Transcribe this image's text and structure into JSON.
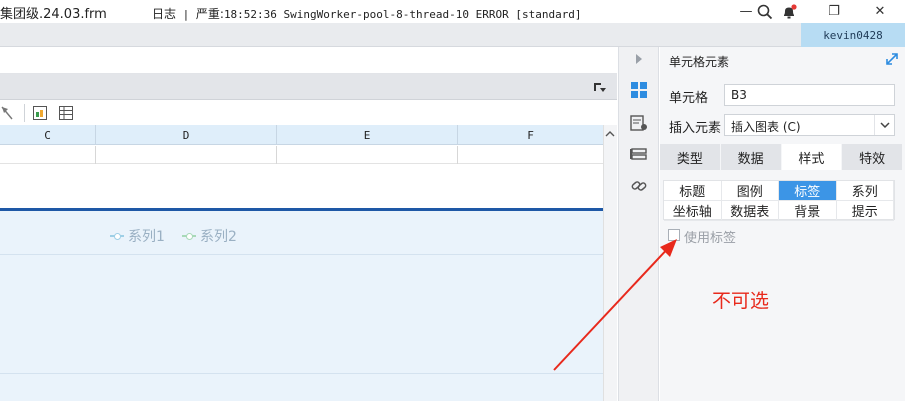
{
  "window": {
    "title": "集团级.24.03.frm",
    "minimize": "—",
    "maximize": "❐",
    "close": "✕"
  },
  "logbar": {
    "log_label": "日志",
    "separator": "|",
    "level_label": "严重:",
    "message": "18:52:36 SwingWorker-pool-8-thread-10 ERROR [standard]",
    "user": "kevin0428"
  },
  "sheet": {
    "columns": [
      "C",
      "D",
      "E",
      "F"
    ]
  },
  "chart": {
    "legend": [
      {
        "name": "系列1",
        "color": "#9ecfe6"
      },
      {
        "name": "系列2",
        "color": "#a8d9b8"
      }
    ]
  },
  "icons": {
    "side": [
      "cell-element-icon",
      "condition-attr-icon",
      "widget-icon",
      "hyperlink-icon"
    ]
  },
  "props": {
    "title": "单元格元素",
    "cell_label": "单元格",
    "cell_value": "B3",
    "insert_label": "插入元素",
    "insert_value": "插入图表",
    "insert_shortcut": "(C)",
    "tabs": [
      "类型",
      "数据",
      "样式",
      "特效"
    ],
    "active_tab": "样式",
    "style_items": [
      "标题",
      "图例",
      "标签",
      "系列",
      "坐标轴",
      "数据表",
      "背景",
      "提示"
    ],
    "selected_item": "标签",
    "use_label": "使用标签",
    "annotation": "不可选"
  }
}
